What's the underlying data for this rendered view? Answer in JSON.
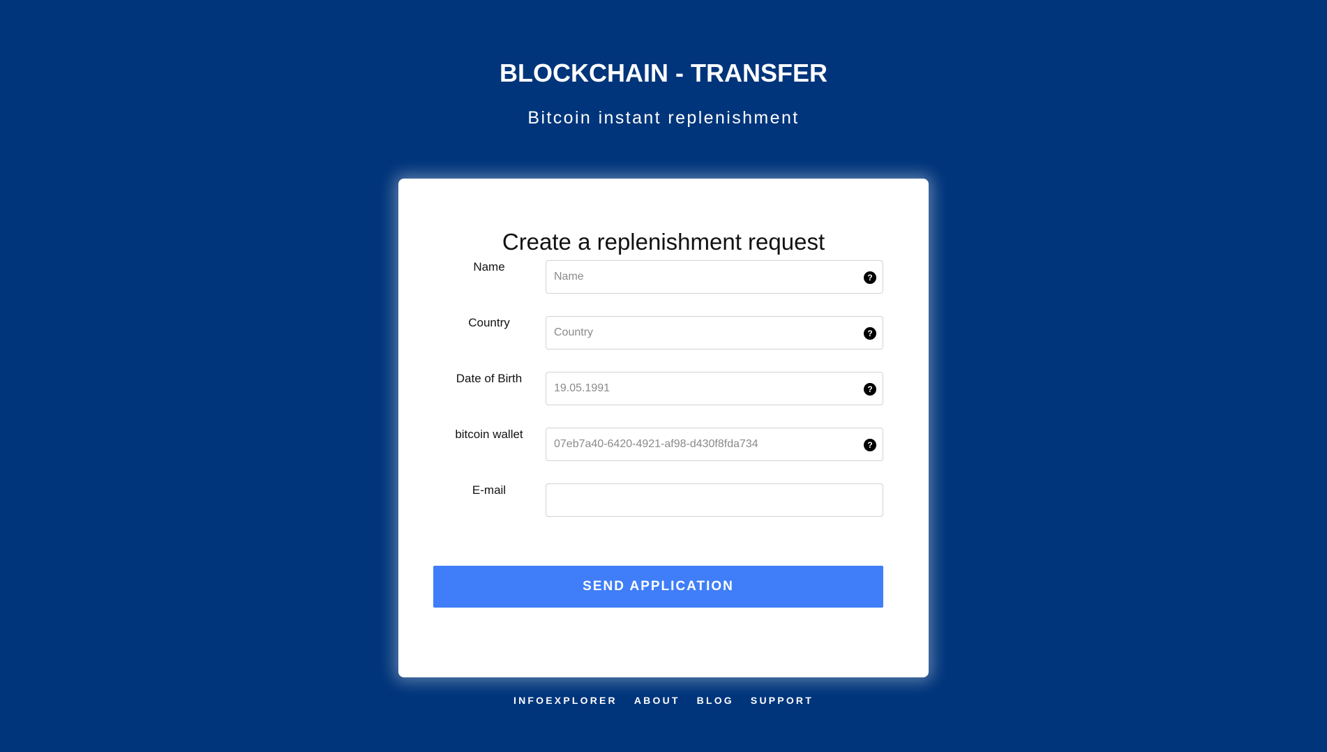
{
  "header": {
    "title": "BLOCKCHAIN - TRANSFER",
    "subtitle": "Bitcoin instant replenishment"
  },
  "form": {
    "title": "Create a replenishment request",
    "fields": [
      {
        "label": "Name",
        "placeholder": "Name",
        "value": "",
        "help_icon": "question-circle-icon"
      },
      {
        "label": "Country",
        "placeholder": "Country",
        "value": "",
        "help_icon": "question-circle-icon"
      },
      {
        "label": "Date of Birth",
        "placeholder": "19.05.1991",
        "value": "",
        "help_icon": "question-circle-icon"
      },
      {
        "label": "bitcoin wallet",
        "placeholder": "07eb7a40-6420-4921-af98-d430f8fda734",
        "value": "",
        "help_icon": "question-circle-icon"
      },
      {
        "label": "E-mail",
        "placeholder": "",
        "value": ""
      }
    ],
    "help_glyph": "?",
    "submit_label": "SEND APPLICATION"
  },
  "footer": {
    "links": [
      "INFOEXPLORER",
      "ABOUT",
      "BLOG",
      "SUPPORT"
    ]
  },
  "colors": {
    "background": "#00357b",
    "card": "#ffffff",
    "button": "#3f7ef8"
  }
}
